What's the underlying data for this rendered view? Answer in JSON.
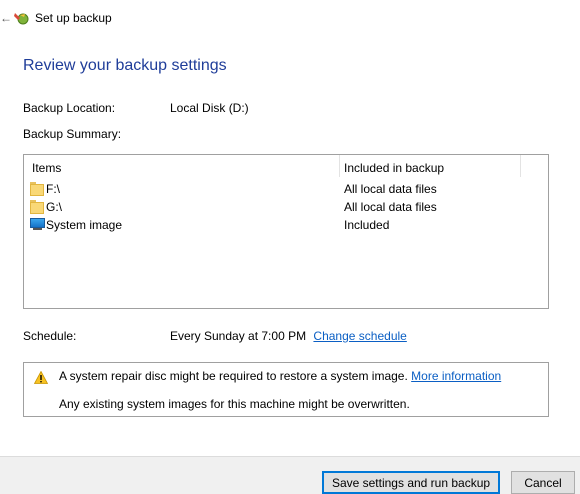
{
  "header": {
    "back_icon": "back-arrow-icon",
    "wizard_icon": "backup-icon",
    "title": "Set up backup"
  },
  "heading": "Review your backup settings",
  "location": {
    "label": "Backup Location:",
    "value": "Local Disk (D:)"
  },
  "summary_label": "Backup Summary:",
  "table": {
    "columns": [
      "Items",
      "Included in backup"
    ],
    "rows": [
      {
        "icon": "folder-icon",
        "name": "F:\\",
        "value": "All local data files"
      },
      {
        "icon": "folder-icon",
        "name": "G:\\",
        "value": "All local data files"
      },
      {
        "icon": "monitor-icon",
        "name": "System image",
        "value": "Included"
      }
    ]
  },
  "schedule": {
    "label": "Schedule:",
    "value": "Every Sunday at 7:00 PM",
    "link": "Change schedule"
  },
  "warning": {
    "icon": "warning-icon",
    "line1": "A system repair disc might be required to restore a system image.",
    "link": "More information",
    "line2": "Any existing system images for this machine might be overwritten."
  },
  "buttons": {
    "save": "Save settings and run backup",
    "cancel": "Cancel"
  },
  "colors": {
    "heading": "#1f3d99",
    "link": "#0b5fc4",
    "primary_border": "#0078d7"
  }
}
